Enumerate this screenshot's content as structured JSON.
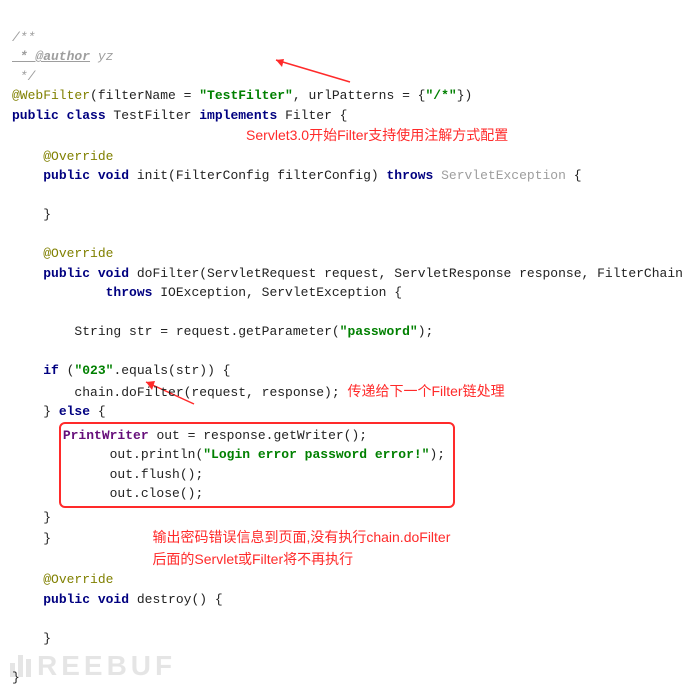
{
  "comment": {
    "open": "/**",
    "author_tag": " * @author",
    "author_name": " yz",
    "close": " */"
  },
  "ann": {
    "at": "@WebFilter",
    "open": "(filterName = ",
    "name": "\"TestFilter\"",
    "mid": ", urlPatterns = {",
    "pat": "\"/*\"",
    "close": "})"
  },
  "cls": {
    "pub": "public ",
    "class": "class ",
    "name": "TestFilter ",
    "impl": "implements ",
    "iface": "Filter {"
  },
  "override": "@Override",
  "init": {
    "sig1": "public ",
    "sig2": "void ",
    "sig3": "init(FilterConfig filterConfig) ",
    "throws": "throws ",
    "exc": "ServletException",
    "brace": " {",
    "close": "}"
  },
  "dofilter": {
    "sig1": "public ",
    "sig2": "void ",
    "sig3": "doFilter(ServletRequest request, ServletResponse response, FilterChain chain)",
    "throws_line": "            throws ",
    "exc": "IOException, ServletException {",
    "str_line": "    String str = request.getParameter(",
    "str_arg": "\"password\"",
    "str_end": ");",
    "if_kw": "if ",
    "if_cond1": "(",
    "if_lit": "\"023\"",
    "if_cond2": ".equals(str)) {",
    "chain": "        chain.doFilter(request, response);",
    "else_close": "} ",
    "else_kw": "else ",
    "else_open": "{",
    "pw1": "PrintWriter out = response.getWriter();",
    "pw2a": "out.println(",
    "pw2b": "\"Login error password error!\"",
    "pw2c": ");",
    "pw3": "out.flush();",
    "pw4": "out.close();",
    "close_else": "    }",
    "close_method": "}"
  },
  "destroy": {
    "sig1": "public ",
    "sig2": "void ",
    "sig3": "destroy() {",
    "close": "}"
  },
  "class_close": "}",
  "notes": {
    "n1": "Servlet3.0开始Filter支持使用注解方式配置",
    "n2": "传递给下一个Filter链处理",
    "n3a": "输出密码错误信息到页面,没有执行chain.doFilter",
    "n3b": "后面的Servlet或Filter将不再执行"
  },
  "watermark": "REEBUF"
}
